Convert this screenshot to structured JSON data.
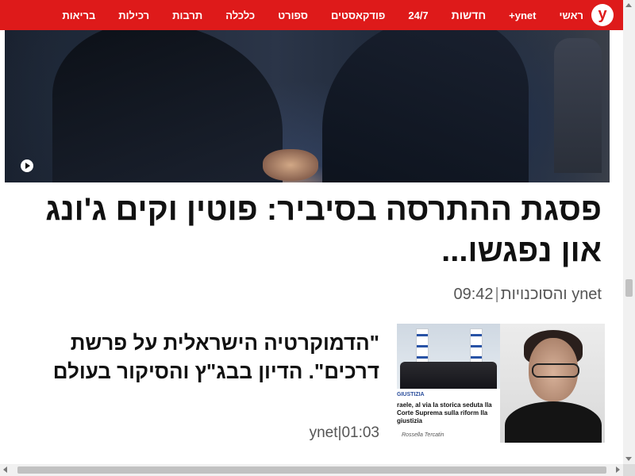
{
  "nav": {
    "logo": "y",
    "items": [
      {
        "label": "ראשי"
      },
      {
        "label": "ynet+"
      },
      {
        "label": "חדשות"
      },
      {
        "label": "24/7"
      },
      {
        "label": "פודקאסטים"
      },
      {
        "label": "ספורט"
      },
      {
        "label": "כלכלה"
      },
      {
        "label": "תרבות"
      },
      {
        "label": "רכילות"
      },
      {
        "label": "בריאות"
      }
    ],
    "active_index": 2
  },
  "main_story": {
    "headline": "פסגת ההתרסה בסיביר: פוטין וקים ג'ונג און נפגשו...",
    "source": "ynet והסוכנויות",
    "time": "09:42"
  },
  "second_story": {
    "title": "\"הדמוקרטיה הישראלית על פרשת דרכים\". הדיון בבג\"ץ והסיקור בעולם",
    "source": "ynet",
    "time": "01:03",
    "thumb": {
      "tag": "GIUSTIZIA",
      "caption": "raele, al via la storica seduta lla Corte Suprema sulla riform lla giustizia",
      "author": "Rossella Tercatin"
    }
  },
  "colors": {
    "brand": "#de1a1a",
    "text": "#111111",
    "meta": "#555555"
  }
}
